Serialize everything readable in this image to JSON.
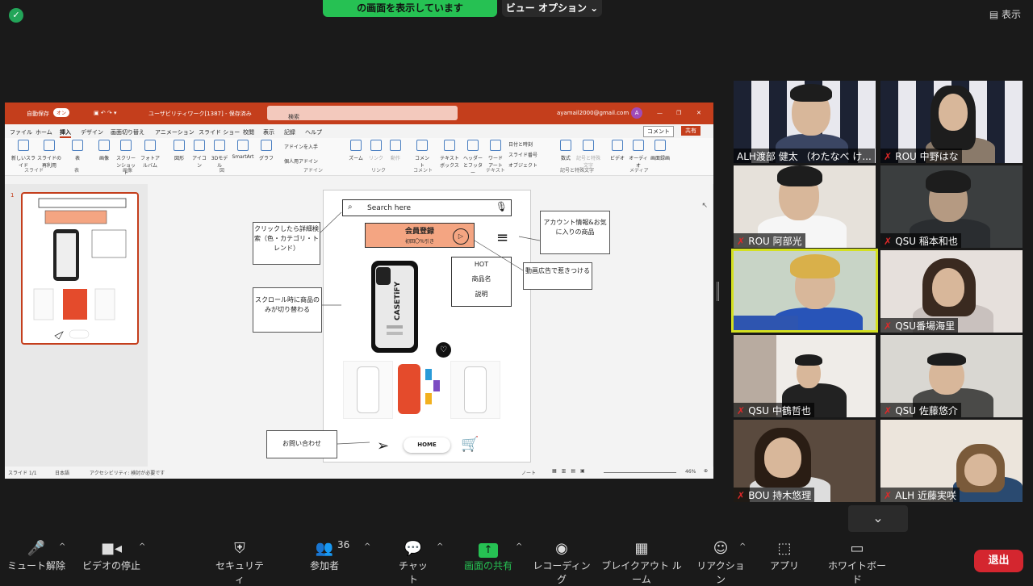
{
  "zoom": {
    "share_banner": "の画面を表示しています",
    "view_options": "ビュー オプション ⌄",
    "display_btn": "表示",
    "participants_count": "36",
    "toolbar": [
      {
        "label": "ミュート解除",
        "icon": "mic-muted-icon"
      },
      {
        "label": "ビデオの停止",
        "icon": "video-icon"
      },
      {
        "label": "セキュリティ",
        "icon": "shield-icon"
      },
      {
        "label": "参加者",
        "icon": "participants-icon"
      },
      {
        "label": "チャット",
        "icon": "chat-icon"
      },
      {
        "label": "画面の共有",
        "icon": "share-screen-icon"
      },
      {
        "label": "レコーディング",
        "icon": "record-icon"
      },
      {
        "label": "ブレイクアウト ルーム",
        "icon": "breakout-icon"
      },
      {
        "label": "リアクション",
        "icon": "reaction-icon"
      },
      {
        "label": "アプリ",
        "icon": "apps-icon"
      },
      {
        "label": "ホワイトボード",
        "icon": "whiteboard-icon"
      }
    ],
    "leave": "退出",
    "gallery": [
      {
        "name": "ALH渡部 健太 （わたなべ け...",
        "muted": false
      },
      {
        "name": "ROU 中野はな",
        "muted": true
      },
      {
        "name": "ROU 阿部光",
        "muted": true
      },
      {
        "name": "QSU 稲本和也",
        "muted": true
      },
      {
        "name": "",
        "muted": false,
        "active": true
      },
      {
        "name": "QSU番場海里",
        "muted": true
      },
      {
        "name": "QSU 中鶴哲也",
        "muted": true
      },
      {
        "name": "QSU 佐藤悠介",
        "muted": true
      },
      {
        "name": "BOU 持木悠理",
        "muted": true
      },
      {
        "name": "ALH 近藤実咲",
        "muted": true
      }
    ],
    "accent": "#26c153"
  },
  "ppt": {
    "autosave": "自動保存",
    "autosave_state": "オン",
    "filename": "ユーザビリティワーク[1387] - 保存済み",
    "search": "検索",
    "account": "ayamail2000@gmail.com",
    "avatar": "A",
    "tabs": [
      "ファイル",
      "ホーム",
      "挿入",
      "デザイン",
      "画面切り替え",
      "アニメーション",
      "スライド ショー",
      "校閲",
      "表示",
      "記録",
      "ヘルプ"
    ],
    "comment_btn": "コメント",
    "share_btn": "共有",
    "ribbon_groups": [
      "スライド",
      "表",
      "画像",
      "図",
      "アドイン",
      "リンク",
      "コメント",
      "テキスト",
      "記号と特殊文字",
      "メディア"
    ],
    "ribbon_items": [
      "新しいスライド",
      "スライドの再利用",
      "表",
      "画像",
      "スクリーンショット",
      "フォトアルバム",
      "図形",
      "アイコン",
      "3Dモデル",
      "SmartArt",
      "グラフ",
      "アドインを入手",
      "個人用アドイン",
      "ズーム",
      "リンク",
      "動作",
      "コメント",
      "テキストボックス",
      "ヘッダーとフッター",
      "ワードアート",
      "日付と時刻",
      "スライド番号",
      "オブジェクト",
      "数式",
      "記号と特殊文字",
      "ビデオ",
      "オーディオ",
      "画面録画"
    ],
    "slide_num": "1",
    "status_left": "スライド 1/1",
    "status_lang": "日本語",
    "status_access": "アクセシビリティ: 検討が必要です",
    "status_notes": "ノート",
    "status_zoom": "46%"
  },
  "slide": {
    "search_placeholder": "Search here",
    "member_title": "会員登録",
    "member_sub": "初回〇％引き",
    "hot_label": "HOT",
    "product_name": "商品名",
    "description": "説明",
    "home": "HOME",
    "callout_search": "クリックしたら詳細検索（色・カテゴリ・トレンド）",
    "callout_account": "アカウント情報&お気に入りの商品",
    "callout_video": "動画広告で惹きつける",
    "callout_scroll": "スクロール時に商品のみが切り替わる",
    "callout_contact": "お問い合わせ",
    "case_brand": "CASETiFY"
  }
}
